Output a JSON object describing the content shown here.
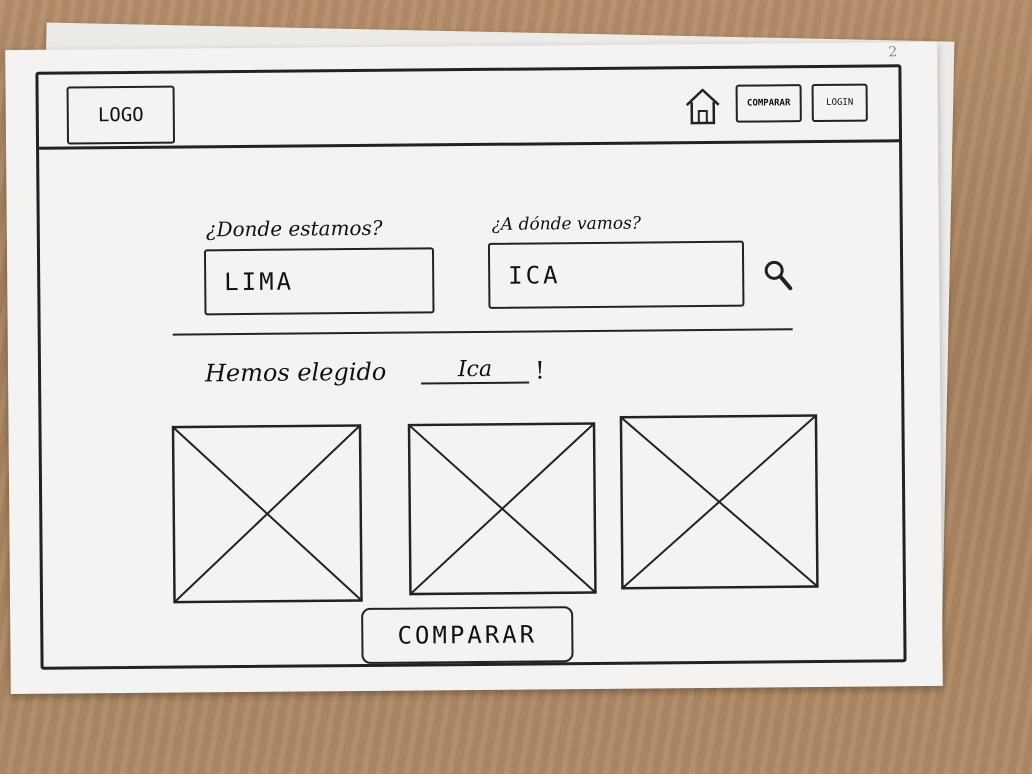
{
  "page_number": "2",
  "header": {
    "logo_label": "LOGO",
    "home_icon": "home-icon",
    "compare_label": "COMPARAR",
    "login_label": "LOGIN"
  },
  "search": {
    "origin_label": "¿Donde estamos?",
    "origin_value": "LIMA",
    "destination_label": "¿A dónde vamos?",
    "destination_value": "ICA",
    "search_icon": "search-icon"
  },
  "result": {
    "prefix": "Hemos elegido",
    "value": "Ica",
    "suffix": "!"
  },
  "images": [
    {
      "icon": "image-placeholder-icon"
    },
    {
      "icon": "image-placeholder-icon"
    },
    {
      "icon": "image-placeholder-icon"
    }
  ],
  "compare_button_label": "COMPARAR"
}
